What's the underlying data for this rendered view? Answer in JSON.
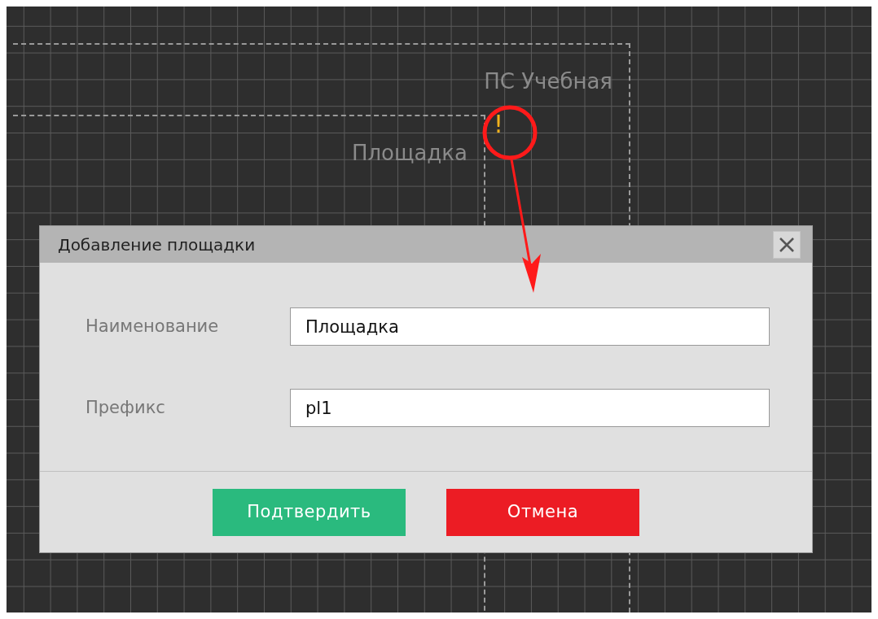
{
  "canvas": {
    "areas": [
      {
        "label": "ПС Учебная"
      },
      {
        "label": "Площадка"
      }
    ],
    "warning": "!"
  },
  "dialog": {
    "title": "Добавление площадки",
    "fields": [
      {
        "label": "Наименование",
        "value": "Площадка"
      },
      {
        "label": "Префикс",
        "value": "pl1"
      }
    ],
    "buttons": [
      {
        "label": "Подтвердить",
        "kind": "confirm"
      },
      {
        "label": "Отмена",
        "kind": "cancel"
      }
    ]
  }
}
